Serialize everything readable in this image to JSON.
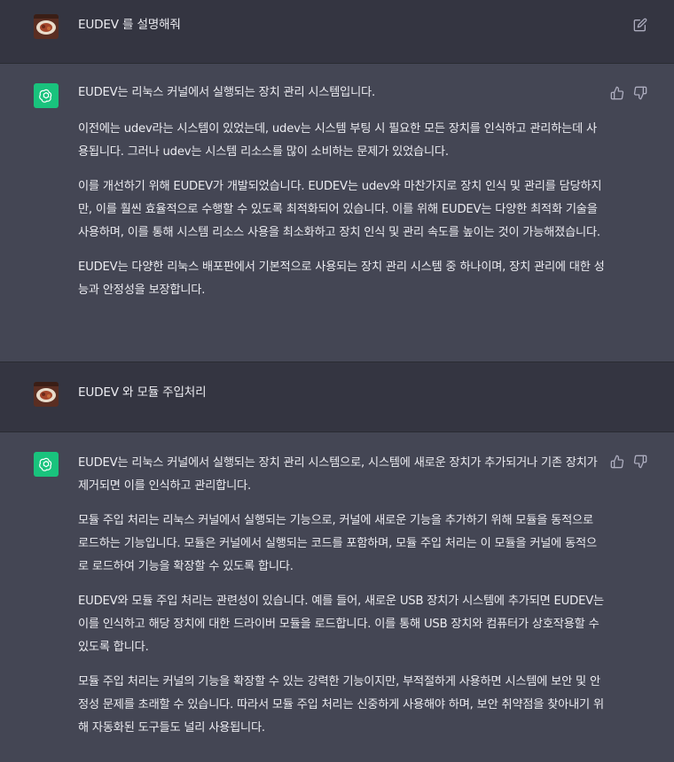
{
  "turns": [
    {
      "role": "user",
      "text": "EUDEV 를 설명해줘"
    },
    {
      "role": "assistant",
      "paragraphs": [
        "EUDEV는 리눅스 커널에서 실행되는 장치 관리 시스템입니다.",
        "이전에는 udev라는 시스템이 있었는데, udev는 시스템 부팅 시 필요한 모든 장치를 인식하고 관리하는데 사용됩니다. 그러나 udev는 시스템 리소스를 많이 소비하는 문제가 있었습니다.",
        "이를 개선하기 위해 EUDEV가 개발되었습니다. EUDEV는 udev와 마찬가지로 장치 인식 및 관리를 담당하지만, 이를 훨씬 효율적으로 수행할 수 있도록 최적화되어 있습니다. 이를 위해 EUDEV는 다양한 최적화 기술을 사용하며, 이를 통해 시스템 리소스 사용을 최소화하고 장치 인식 및 관리 속도를 높이는 것이 가능해졌습니다.",
        "EUDEV는 다양한 리눅스 배포판에서 기본적으로 사용되는 장치 관리 시스템 중 하나이며, 장치 관리에 대한 성능과 안정성을 보장합니다."
      ]
    },
    {
      "role": "user",
      "text": "EUDEV 와 모듈 주입처리"
    },
    {
      "role": "assistant",
      "paragraphs": [
        "EUDEV는 리눅스 커널에서 실행되는 장치 관리 시스템으로, 시스템에 새로운 장치가 추가되거나 기존 장치가 제거되면 이를 인식하고 관리합니다.",
        "모듈 주입 처리는 리눅스 커널에서 실행되는 기능으로, 커널에 새로운 기능을 추가하기 위해 모듈을 동적으로 로드하는 기능입니다. 모듈은 커널에서 실행되는 코드를 포함하며, 모듈 주입 처리는 이 모듈을 커널에 동적으로 로드하여 기능을 확장할 수 있도록 합니다.",
        "EUDEV와 모듈 주입 처리는 관련성이 있습니다. 예를 들어, 새로운 USB 장치가 시스템에 추가되면 EUDEV는 이를 인식하고 해당 장치에 대한 드라이버 모듈을 로드합니다. 이를 통해 USB 장치와 컴퓨터가 상호작용할 수 있도록 합니다.",
        "모듈 주입 처리는 커널의 기능을 확장할 수 있는 강력한 기능이지만, 부적절하게 사용하면 시스템에 보안 및 안정성 문제를 초래할 수 있습니다. 따라서 모듈 주입 처리는 신중하게 사용해야 하며, 보안 취약점을 찾아내기 위해 자동화된 도구들도 널리 사용됩니다."
      ]
    }
  ],
  "icons": {
    "edit": "edit-icon",
    "thumbs_up": "thumbs-up-icon",
    "thumbs_down": "thumbs-down-icon",
    "bot": "openai-logo-icon"
  },
  "colors": {
    "user_bg": "#343541",
    "assistant_bg": "#444654",
    "bot_avatar": "#19c37d"
  }
}
